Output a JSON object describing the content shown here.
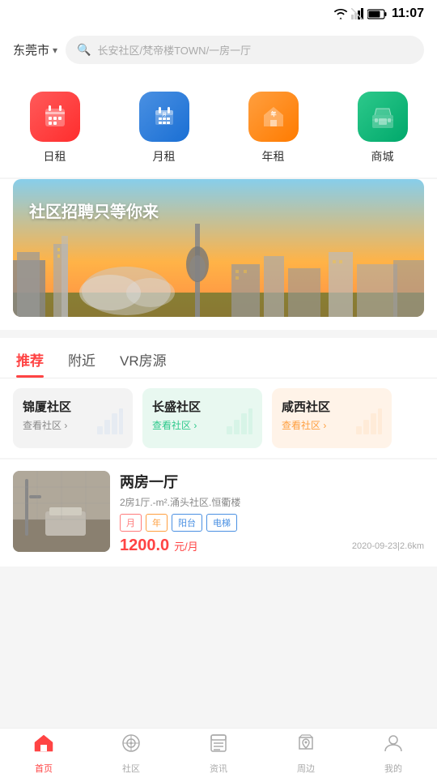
{
  "statusBar": {
    "time": "11:07"
  },
  "searchBar": {
    "cityName": "东莞市",
    "placeholder": "长安社区/梵帝楼TOWN/一房一厅"
  },
  "categories": [
    {
      "id": "daily",
      "label": "日租",
      "colorClass": "cat-red",
      "icon": "📅"
    },
    {
      "id": "monthly",
      "label": "月租",
      "colorClass": "cat-blue",
      "icon": "🏢"
    },
    {
      "id": "yearly",
      "label": "年租",
      "colorClass": "cat-orange",
      "icon": "🏠"
    },
    {
      "id": "mall",
      "label": "商城",
      "colorClass": "cat-green",
      "icon": "🏪"
    }
  ],
  "banner": {
    "text": "社区招聘只等你来"
  },
  "tabs": [
    {
      "id": "recommend",
      "label": "推荐",
      "active": true
    },
    {
      "id": "nearby",
      "label": "附近",
      "active": false
    },
    {
      "id": "vr",
      "label": "VR房源",
      "active": false
    }
  ],
  "communities": [
    {
      "name": "锦厦社区",
      "linkLabel": "查看社区 ›",
      "cardClass": "card-gray",
      "linkClass": "",
      "iconClass": "blue"
    },
    {
      "name": "长盛社区",
      "linkLabel": "查看社区 ›",
      "cardClass": "card-light-green",
      "linkClass": "green",
      "iconClass": "green"
    },
    {
      "name": "咸西社区",
      "linkLabel": "查看社区 ›",
      "cardClass": "card-light-orange",
      "linkClass": "orange",
      "iconClass": "orange"
    }
  ],
  "listing": {
    "title": "两房一厅",
    "desc": "2房1厅.-m².涌头社区.恒衢楼",
    "tags": [
      "月",
      "年",
      "阳台",
      "电梯"
    ],
    "price": "1200.0",
    "priceUnit": "元/月",
    "meta": "2020-09-23|2.6km"
  },
  "bottomNav": [
    {
      "id": "home",
      "label": "首页",
      "active": true,
      "icon": "⌂"
    },
    {
      "id": "community",
      "label": "社区",
      "active": false,
      "icon": "◎"
    },
    {
      "id": "news",
      "label": "资讯",
      "active": false,
      "icon": "📋"
    },
    {
      "id": "nearby",
      "label": "周边",
      "active": false,
      "icon": "🛍"
    },
    {
      "id": "mine",
      "label": "我的",
      "active": false,
      "icon": "👤"
    }
  ]
}
